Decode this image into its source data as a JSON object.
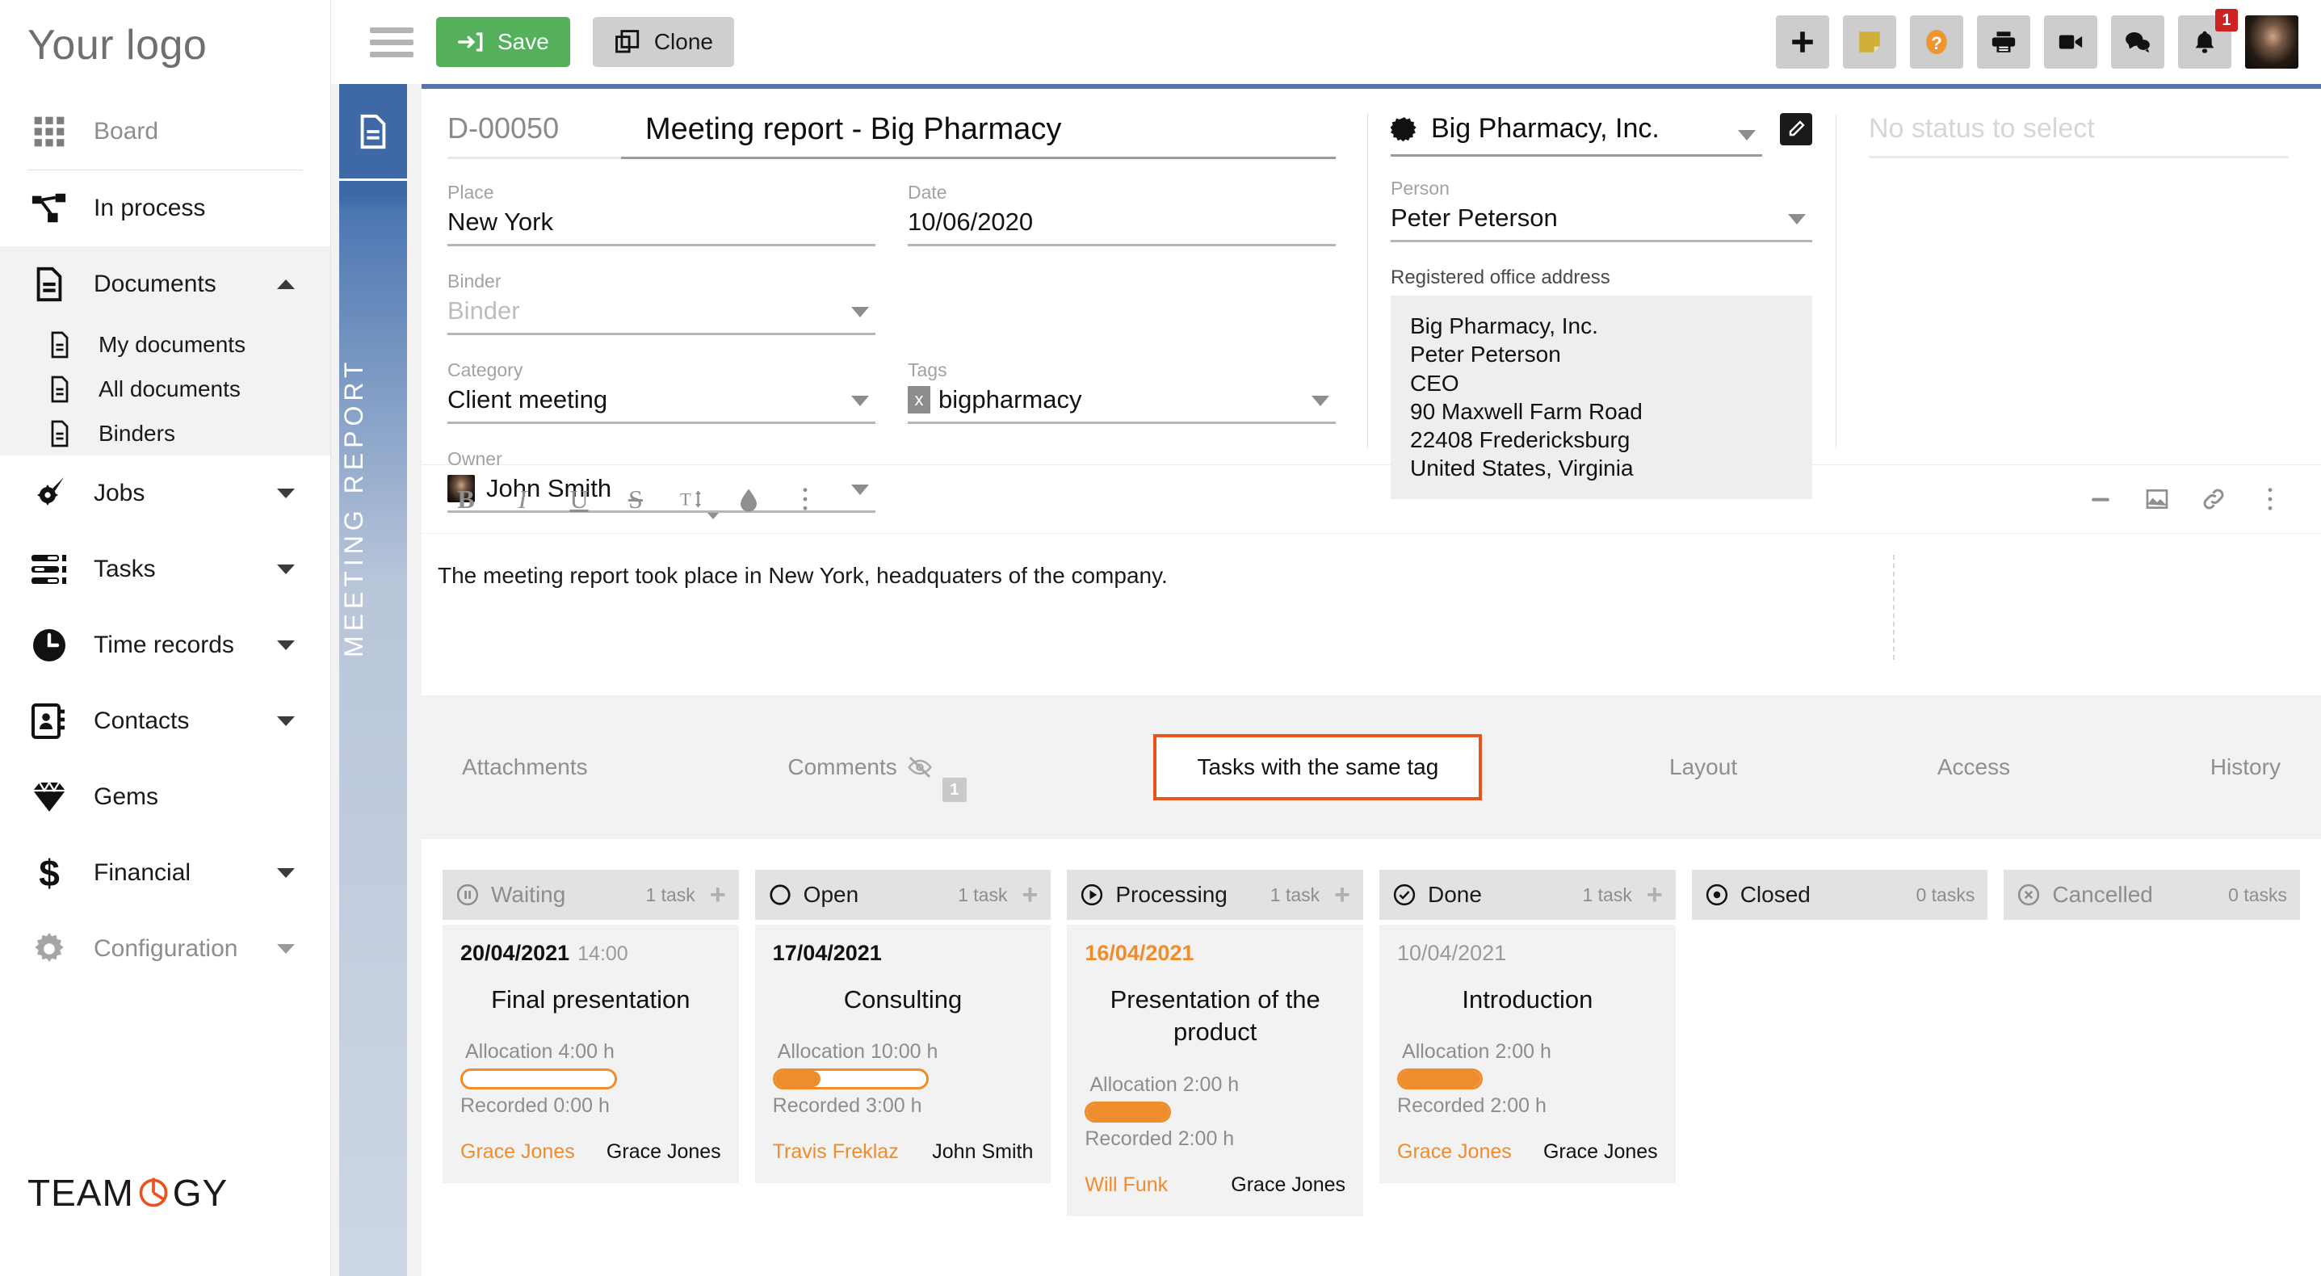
{
  "sidebar": {
    "logo": "Your logo",
    "items": [
      {
        "label": "Board",
        "icon": "grid-icon",
        "muted": true,
        "level": 0,
        "caret": null
      },
      {
        "label": "In process",
        "icon": "flow-icon",
        "muted": false,
        "level": 0,
        "caret": null
      },
      {
        "label": "Documents",
        "icon": "document-icon",
        "muted": false,
        "level": 0,
        "caret": "up"
      },
      {
        "label": "My documents",
        "icon": "file-icon",
        "muted": false,
        "level": 1,
        "caret": null
      },
      {
        "label": "All documents",
        "icon": "file-icon",
        "muted": false,
        "level": 1,
        "caret": null
      },
      {
        "label": "Binders",
        "icon": "file-icon",
        "muted": false,
        "level": 1,
        "caret": null
      },
      {
        "label": "Jobs",
        "icon": "rocket-gear-icon",
        "muted": false,
        "level": 0,
        "caret": "down"
      },
      {
        "label": "Tasks",
        "icon": "list-icon",
        "muted": false,
        "level": 0,
        "caret": "down"
      },
      {
        "label": "Time records",
        "icon": "clock-icon",
        "muted": false,
        "level": 0,
        "caret": "down"
      },
      {
        "label": "Contacts",
        "icon": "contacts-book-icon",
        "muted": false,
        "level": 0,
        "caret": "down"
      },
      {
        "label": "Gems",
        "icon": "gem-icon",
        "muted": false,
        "level": 0,
        "caret": null
      },
      {
        "label": "Financial",
        "icon": "dollar-icon",
        "muted": false,
        "level": 0,
        "caret": "down"
      },
      {
        "label": "Configuration",
        "icon": "gear-icon",
        "muted": true,
        "level": 0,
        "caret": "down"
      }
    ],
    "footer_logo": "TEAM",
    "footer_logo_2": "GY"
  },
  "topbar": {
    "save_label": "Save",
    "clone_label": "Clone",
    "notification_badge": "1",
    "icons": [
      "plus-icon",
      "note-icon",
      "help-icon",
      "print-icon",
      "video-icon",
      "chat-icon",
      "bell-icon",
      "avatar"
    ]
  },
  "ribbon": {
    "label": "MEETING REPORT",
    "icon": "document-icon"
  },
  "document": {
    "id": "D-00050",
    "title": "Meeting report - Big Pharmacy",
    "fields": {
      "place": {
        "label": "Place",
        "value": "New York"
      },
      "date": {
        "label": "Date",
        "value": "10/06/2020"
      },
      "binder": {
        "label": "Binder",
        "value": "Binder",
        "is_placeholder": true
      },
      "category": {
        "label": "Category",
        "value": "Client meeting"
      },
      "tags": {
        "label": "Tags",
        "chip": "x",
        "value": "bigpharmacy"
      },
      "owner": {
        "label": "Owner",
        "value": "John Smith"
      }
    }
  },
  "company": {
    "name": "Big Pharmacy, Inc.",
    "person_label": "Person",
    "person_value": "Peter Peterson",
    "address_label": "Registered office address",
    "address_lines": [
      "Big Pharmacy, Inc.",
      "Peter Peterson",
      "CEO",
      "90 Maxwell Farm Road",
      "22408 Fredericksburg",
      "United States, Virginia"
    ]
  },
  "status": {
    "placeholder": "No status to select"
  },
  "editor": {
    "toolbar_left": [
      "bold-icon",
      "italic-icon",
      "underline-icon",
      "strikethrough-icon",
      "font-size-icon",
      "text-color-icon",
      "more-icon"
    ],
    "toolbar_right": [
      "minus-icon",
      "image-icon",
      "link-icon",
      "more-icon"
    ],
    "bold": "B",
    "italic": "I",
    "underline": "U",
    "strike": "S",
    "body_text": "The meeting report took place in New York, headquaters of the company."
  },
  "tabs": [
    {
      "label": "Attachments",
      "active": false,
      "badge": null,
      "icon": null
    },
    {
      "label": "Comments",
      "active": false,
      "badge": "1",
      "icon": "eye-off-icon"
    },
    {
      "label": "Tasks with the same tag",
      "active": true,
      "badge": null,
      "icon": null
    },
    {
      "label": "Layout",
      "active": false,
      "badge": null,
      "icon": null
    },
    {
      "label": "Access",
      "active": false,
      "badge": null,
      "icon": null
    },
    {
      "label": "History",
      "active": false,
      "badge": null,
      "icon": null
    }
  ],
  "kanban": {
    "columns": [
      {
        "title": "Waiting",
        "icon": "pause-circle-icon",
        "count": "1 task",
        "dim": true,
        "cards": [
          {
            "date": "20/04/2021",
            "date_style": "normal",
            "time": "14:00",
            "name": "Final presentation",
            "allocation": "Allocation 4:00 h",
            "recorded": "Recorded 0:00 h",
            "progress_percent": 0,
            "bar_width_percent": 60,
            "assignee": "Grace Jones",
            "owner": "Grace Jones"
          }
        ]
      },
      {
        "title": "Open",
        "icon": "circle-icon",
        "count": "1 task",
        "dim": false,
        "cards": [
          {
            "date": "17/04/2021",
            "date_style": "normal",
            "time": "",
            "name": "Consulting",
            "allocation": "Allocation 10:00 h",
            "recorded": "Recorded 3:00 h",
            "progress_percent": 30,
            "bar_width_percent": 60,
            "assignee": "Travis Freklaz",
            "owner": "John Smith"
          }
        ]
      },
      {
        "title": "Processing",
        "icon": "play-circle-icon",
        "count": "1 task",
        "dim": false,
        "cards": [
          {
            "date": "16/04/2021",
            "date_style": "orange",
            "time": "",
            "name": "Presentation of the product",
            "allocation": "Allocation 2:00 h",
            "recorded": "Recorded 2:00 h",
            "progress_percent": 100,
            "bar_width_percent": 33,
            "assignee": "Will Funk",
            "owner": "Grace Jones"
          }
        ]
      },
      {
        "title": "Done",
        "icon": "check-circle-icon",
        "count": "1 task",
        "dim": false,
        "cards": [
          {
            "date": "10/04/2021",
            "date_style": "grey",
            "time": "",
            "name": "Introduction",
            "allocation": "Allocation 2:00 h",
            "recorded": "Recorded 2:00 h",
            "progress_percent": 100,
            "bar_width_percent": 33,
            "assignee": "Grace Jones",
            "owner": "Grace Jones"
          }
        ]
      },
      {
        "title": "Closed",
        "icon": "dot-circle-icon",
        "count": "0 tasks",
        "dim": false,
        "cards": []
      },
      {
        "title": "Cancelled",
        "icon": "x-circle-icon",
        "count": "0 tasks",
        "dim": true,
        "cards": []
      }
    ]
  },
  "colors": {
    "accent_orange": "#ef8c2b",
    "tab_highlight": "#e8531f",
    "save_green": "#54b05a",
    "ribbon_blue": "#3f69a6",
    "badge_red": "#cc2222"
  }
}
